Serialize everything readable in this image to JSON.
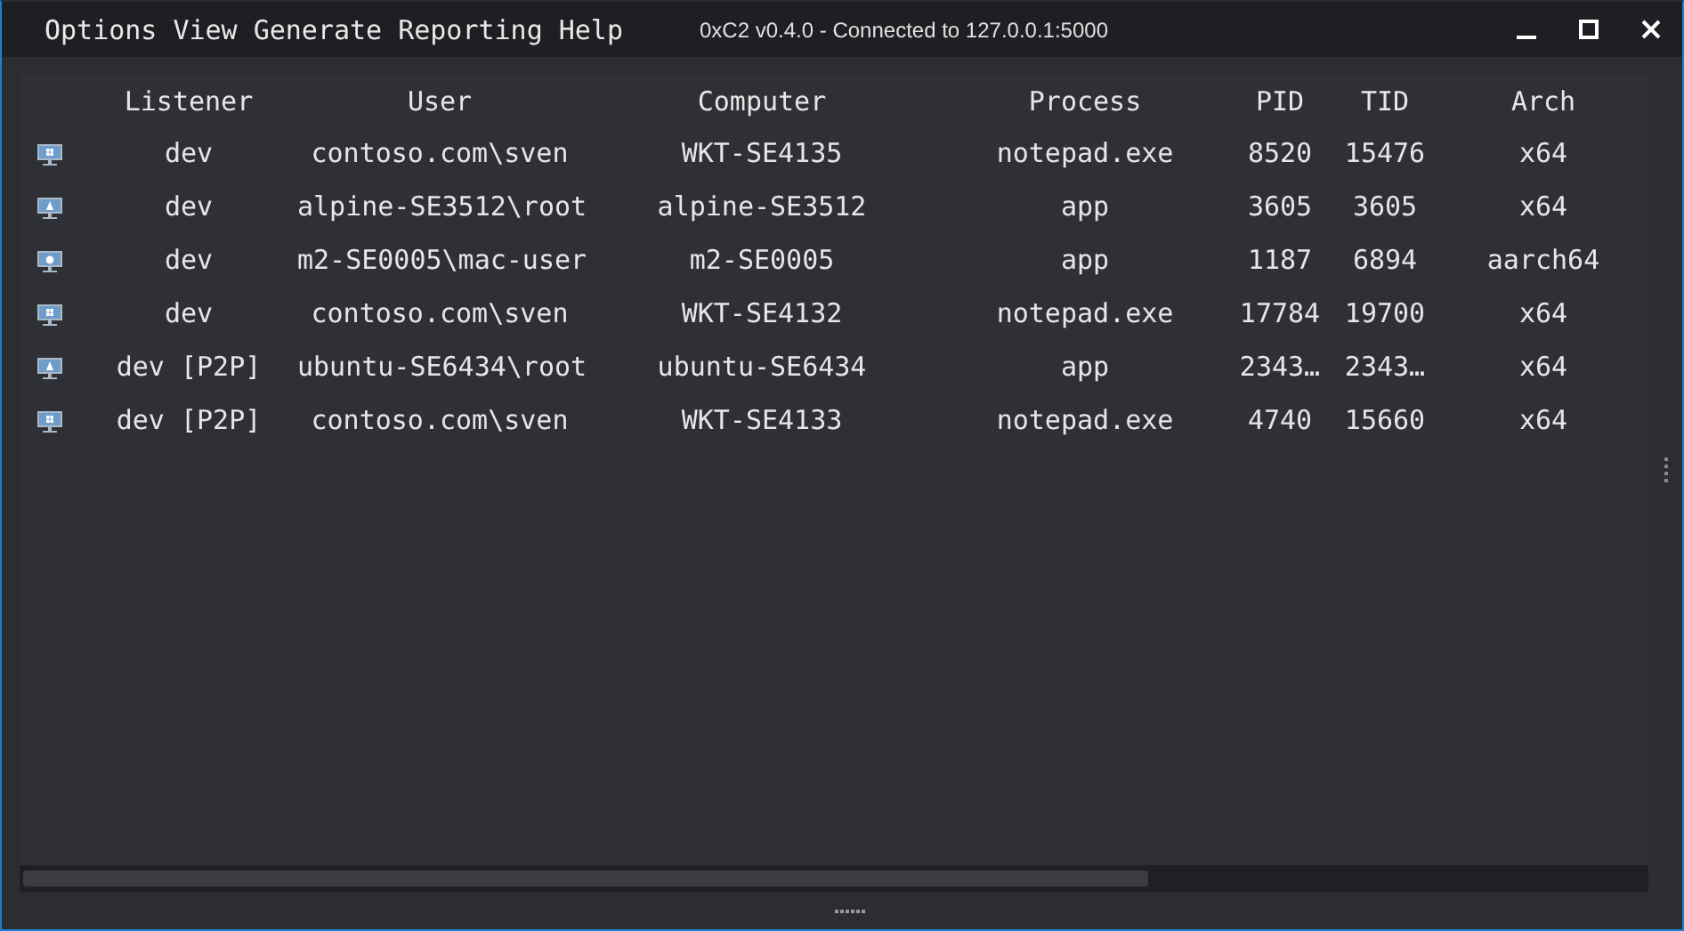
{
  "menu": [
    "Options",
    "View",
    "Generate",
    "Reporting",
    "Help"
  ],
  "window": {
    "title": "0xC2 v0.4.0 - Connected to 127.0.0.1:5000"
  },
  "table": {
    "columns": [
      "Listener",
      "User",
      "Computer",
      "Process",
      "PID",
      "TID",
      "Arch"
    ],
    "rows": [
      {
        "kind": "windows",
        "cells": [
          "dev",
          "contoso.com\\sven",
          "WKT-SE4135",
          "notepad.exe",
          "8520",
          "15476",
          "x64"
        ]
      },
      {
        "kind": "linux",
        "cells": [
          "dev",
          "alpine-SE3512\\root",
          "alpine-SE3512",
          "app",
          "3605",
          "3605",
          "x64"
        ]
      },
      {
        "kind": "mac",
        "cells": [
          "dev",
          "m2-SE0005\\mac-user",
          "m2-SE0005",
          "app",
          "1187",
          "6894",
          "aarch64"
        ]
      },
      {
        "kind": "windows",
        "cells": [
          "dev",
          "contoso.com\\sven",
          "WKT-SE4132",
          "notepad.exe",
          "17784",
          "19700",
          "x64"
        ]
      },
      {
        "kind": "linux",
        "cells": [
          "dev [P2P]",
          "ubuntu-SE6434\\root",
          "ubuntu-SE6434",
          "app",
          "2343…",
          "2343…",
          "x64"
        ]
      },
      {
        "kind": "windows",
        "cells": [
          "dev [P2P]",
          "contoso.com\\sven",
          "WKT-SE4133",
          "notepad.exe",
          "4740",
          "15660",
          "x64"
        ]
      }
    ]
  }
}
